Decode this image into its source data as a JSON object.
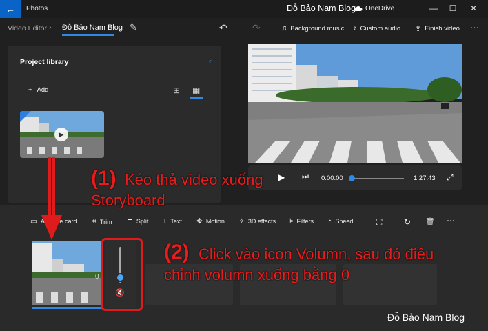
{
  "titlebar": {
    "app_title": "Photos",
    "watermark": "Đỗ Bảo Nam Blog",
    "onedrive": "OneDrive",
    "minimize": "—",
    "maximize": "☐",
    "close": "✕",
    "back_icon": "←"
  },
  "toolbar": {
    "breadcrumb_parent": "Video Editor",
    "breadcrumb_separator": "›",
    "project_name": "Đỗ Bảo Nam Blog",
    "edit_icon": "✎",
    "undo_icon": "↶",
    "redo_icon": "↷",
    "background_music": "Background music",
    "custom_audio": "Custom audio",
    "finish_video": "Finish video",
    "more_icon": "···"
  },
  "library": {
    "title": "Project library",
    "collapse_icon": "‹",
    "add_label": "Add",
    "add_icon": "+",
    "grid_small_icon": "⊞",
    "grid_large_icon": "▦"
  },
  "player": {
    "play_icon": "▶",
    "step_icon": "⏭",
    "current_time": "0:00.00",
    "total_time": "1:27.43",
    "progress": 0,
    "fullscreen_icon": "⤢"
  },
  "storyboard": {
    "tools": [
      {
        "icon": "▭",
        "label": "Add title card"
      },
      {
        "icon": "⌗",
        "label": "Trim"
      },
      {
        "icon": "⊏",
        "label": "Split"
      },
      {
        "icon": "T",
        "label": "Text"
      },
      {
        "icon": "✥",
        "label": "Motion"
      },
      {
        "icon": "✧",
        "label": "3D effects"
      },
      {
        "icon": "⊧",
        "label": "Filters"
      },
      {
        "icon": "◔",
        "label": "Speed"
      }
    ],
    "crop_icon": "⛶",
    "rotate_icon": "↻",
    "delete_icon": "🗑",
    "more_icon": "···",
    "clip_duration": "0",
    "volume_level": 0.15,
    "mute_icon": "🔇"
  },
  "annotations": {
    "step1_number": "(1)",
    "step1_text_a": "Kéo thả video xuống",
    "step1_text_b": "Storyboard",
    "step2_number": "(2)",
    "step2_text_a": "Click vào icon Volumn, sau đó điều",
    "step2_text_b": "chỉnh volumn xuống bằng 0"
  },
  "watermark_bottom": "Đỗ Bảo Nam Blog",
  "colors": {
    "accent": "#2e8ae6",
    "annotation_red": "#e01b1b",
    "background": "#202020",
    "panel": "#2b2b2b"
  }
}
